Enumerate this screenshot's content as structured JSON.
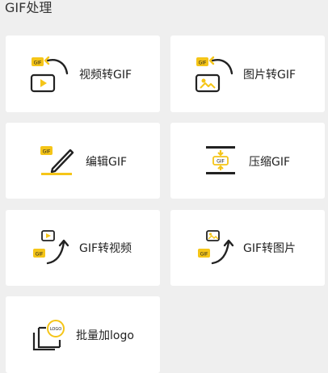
{
  "header": {
    "title": "GIF处理"
  },
  "tools": [
    {
      "label": "视频转GIF",
      "icon": "video-to-gif-icon"
    },
    {
      "label": "图片转GIF",
      "icon": "image-to-gif-icon"
    },
    {
      "label": "编辑GIF",
      "icon": "edit-gif-icon"
    },
    {
      "label": "压缩GIF",
      "icon": "compress-gif-icon"
    },
    {
      "label": "GIF转视频",
      "icon": "gif-to-video-icon"
    },
    {
      "label": "GIF转图片",
      "icon": "gif-to-image-icon"
    },
    {
      "label": "批量加logo",
      "icon": "batch-logo-icon"
    }
  ],
  "colors": {
    "accent": "#F5C518",
    "ink": "#222222",
    "card": "#FFFFFF",
    "background": "#EFEFEF"
  }
}
